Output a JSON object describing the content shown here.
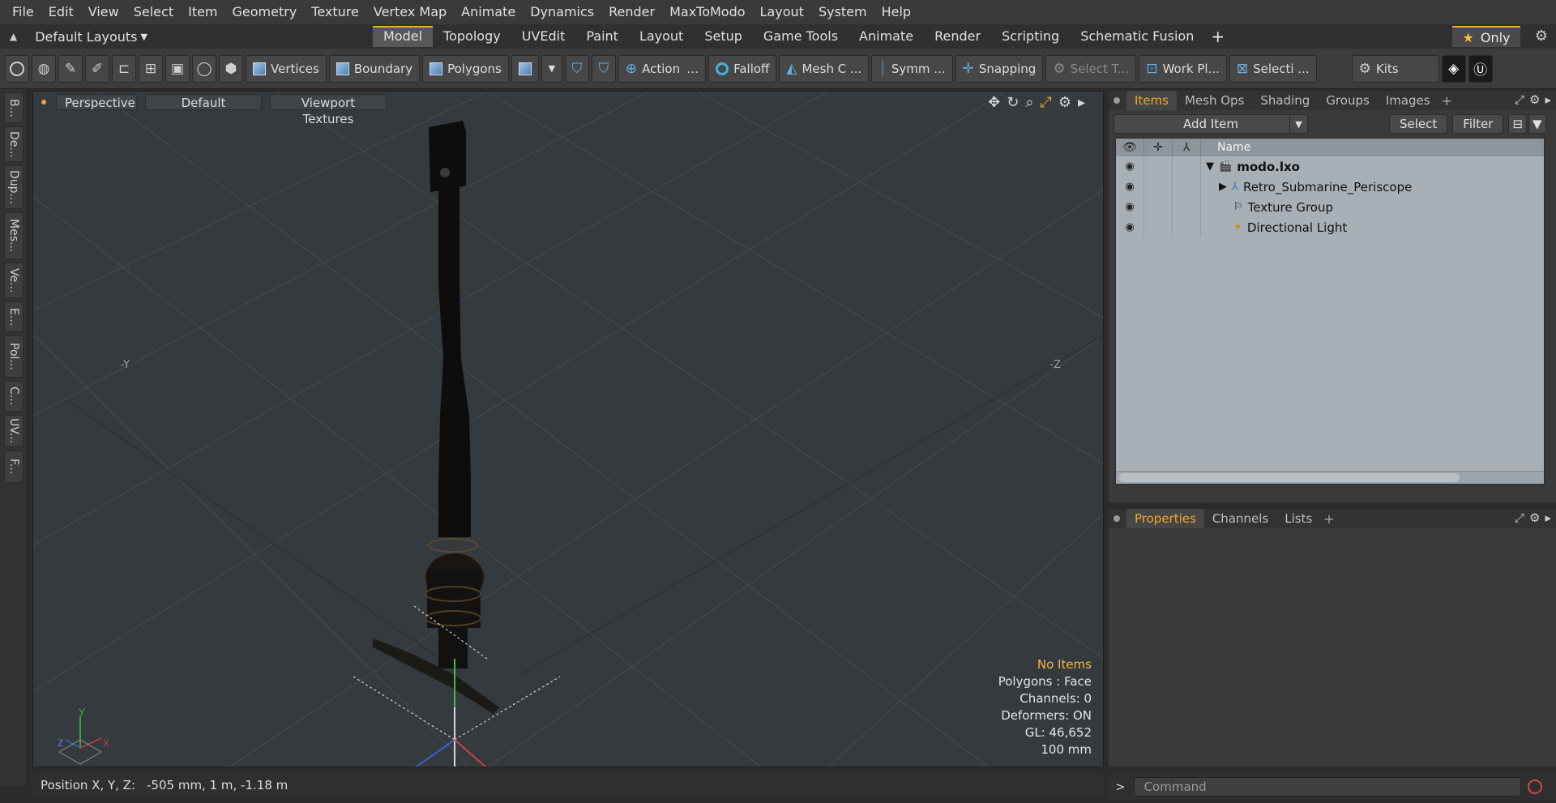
{
  "menu": [
    "File",
    "Edit",
    "View",
    "Select",
    "Item",
    "Geometry",
    "Texture",
    "Vertex Map",
    "Animate",
    "Dynamics",
    "Render",
    "MaxToModo",
    "Layout",
    "System",
    "Help"
  ],
  "layouts": {
    "label": "Default Layouts",
    "tabs": [
      "Model",
      "Topology",
      "UVEdit",
      "Paint",
      "Layout",
      "Setup",
      "Game Tools",
      "Animate",
      "Render",
      "Scripting",
      "Schematic Fusion"
    ],
    "active_tab": "Model",
    "only_label": "Only"
  },
  "toolbar": {
    "vertices": "Vertices",
    "boundary": "Boundary",
    "polygons": "Polygons",
    "action": "Action",
    "falloff": "Falloff",
    "mesh": "Mesh C ...",
    "symmetry": "Symm ...",
    "snapping": "Snapping",
    "select_t": "Select T...",
    "work_plane": "Work Pl...",
    "selection": "Selecti ...",
    "kits": "Kits"
  },
  "left_tabs": [
    "B...",
    "De...",
    "Dup...",
    "Mes...",
    "Ve...",
    "E...",
    "Pol...",
    "C...",
    "UV...",
    "F..."
  ],
  "viewport": {
    "view": "Perspective",
    "shading": "Default",
    "textures": "Viewport Textures",
    "axis_left": "-Y",
    "axis_right": "-Z",
    "stats": {
      "selection": "No Items",
      "polygons": "Polygons : Face",
      "channels": "Channels: 0",
      "deformers": "Deformers: ON",
      "gl": "GL: 46,652",
      "scale": "100 mm"
    }
  },
  "status": {
    "label": "Position X, Y, Z:",
    "value": "-505 mm, 1 m, -1.18 m"
  },
  "items_panel": {
    "tabs": [
      "Items",
      "Mesh Ops",
      "Shading",
      "Groups",
      "Images"
    ],
    "active_tab": "Items",
    "add_item": "Add Item",
    "select": "Select",
    "filter": "Filter",
    "name_header": "Name",
    "tree": [
      {
        "label": "modo.lxo",
        "kind": "scene"
      },
      {
        "label": "Retro_Submarine_Periscope",
        "kind": "mesh"
      },
      {
        "label": "Texture Group",
        "kind": "group"
      },
      {
        "label": "Directional Light",
        "kind": "light"
      }
    ]
  },
  "properties_panel": {
    "tabs": [
      "Properties",
      "Channels",
      "Lists"
    ],
    "active_tab": "Properties"
  },
  "command": {
    "prompt": ">",
    "placeholder": "Command"
  },
  "colors": {
    "accent": "#f0a830",
    "viewport_bg": "#353a3f",
    "tree_bg": "#a9b0b5"
  }
}
